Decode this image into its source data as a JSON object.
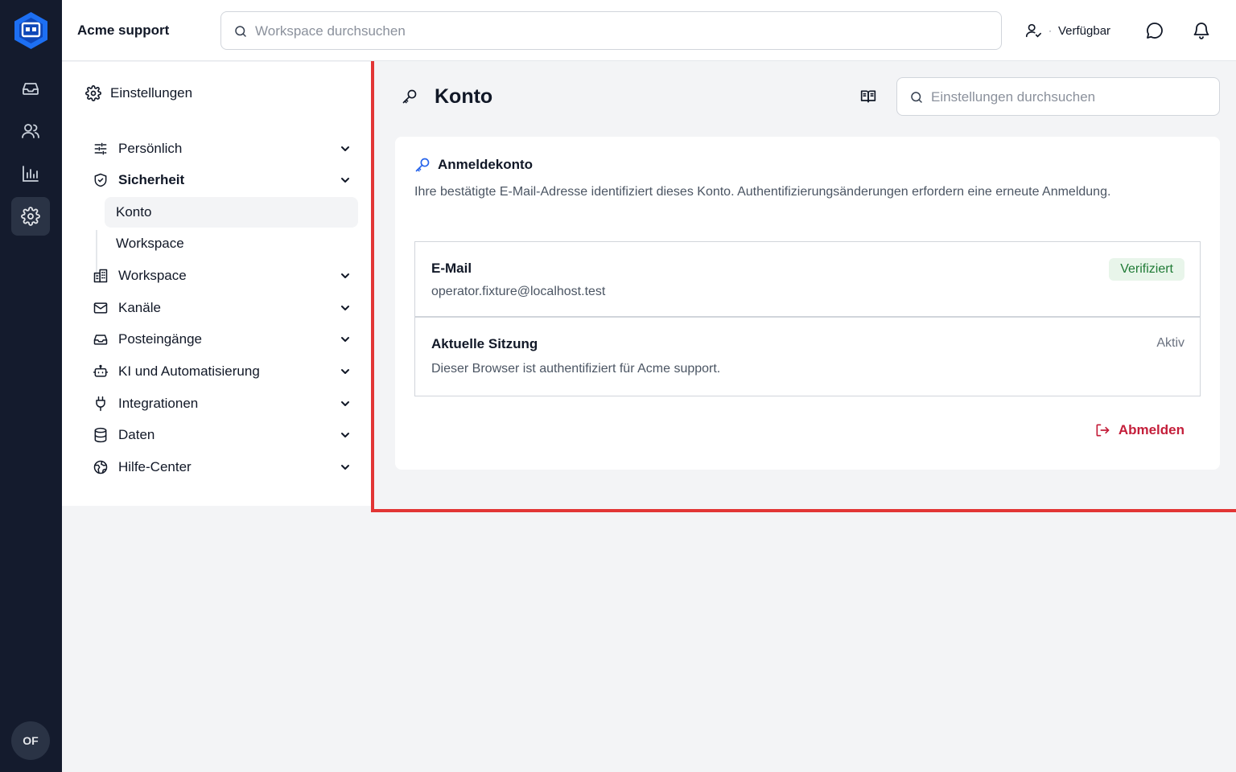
{
  "app": {
    "brand": "Acme support",
    "avatar_initials": "OF",
    "accent_color": "#2563eb",
    "danger_color": "#c41e3a"
  },
  "topbar": {
    "search_placeholder": "Workspace durchsuchen",
    "status_label": "Verfügbar",
    "status_separator": "·"
  },
  "rail": {
    "items": [
      {
        "icon": "inbox-icon"
      },
      {
        "icon": "users-icon"
      },
      {
        "icon": "bar-chart-icon"
      },
      {
        "icon": "gear-icon",
        "active": true
      }
    ]
  },
  "sidebar": {
    "title": "Einstellungen",
    "items": [
      {
        "label": "Persönlich",
        "icon": "sliders-icon"
      },
      {
        "label": "Sicherheit",
        "icon": "shield-icon",
        "expanded": true
      },
      {
        "label": "Workspace",
        "icon": "building-icon"
      },
      {
        "label": "Kanäle",
        "icon": "mail-icon"
      },
      {
        "label": "Posteingänge",
        "icon": "inbox-icon"
      },
      {
        "label": "KI und Automatisierung",
        "icon": "bot-icon"
      },
      {
        "label": "Integrationen",
        "icon": "plug-icon"
      },
      {
        "label": "Daten",
        "icon": "database-icon"
      },
      {
        "label": "Hilfe-Center",
        "icon": "globe-icon"
      }
    ],
    "security_sub": [
      {
        "label": "Konto",
        "active": true
      },
      {
        "label": "Workspace"
      }
    ]
  },
  "main": {
    "title": "Konto",
    "search_placeholder": "Einstellungen durchsuchen",
    "card": {
      "heading": "Anmeldekonto",
      "description": "Ihre bestätigte E-Mail-Adresse identifiziert dieses Konto. Authentifizierungsänderungen erfordern eine erneute Anmeldung.",
      "email": {
        "label": "E-Mail",
        "value": "operator.fixture@localhost.test",
        "badge": "Verifiziert"
      },
      "session": {
        "label": "Aktuelle Sitzung",
        "value": "Dieser Browser ist authentifiziert für Acme support.",
        "status": "Aktiv"
      },
      "logout_label": "Abmelden"
    }
  }
}
